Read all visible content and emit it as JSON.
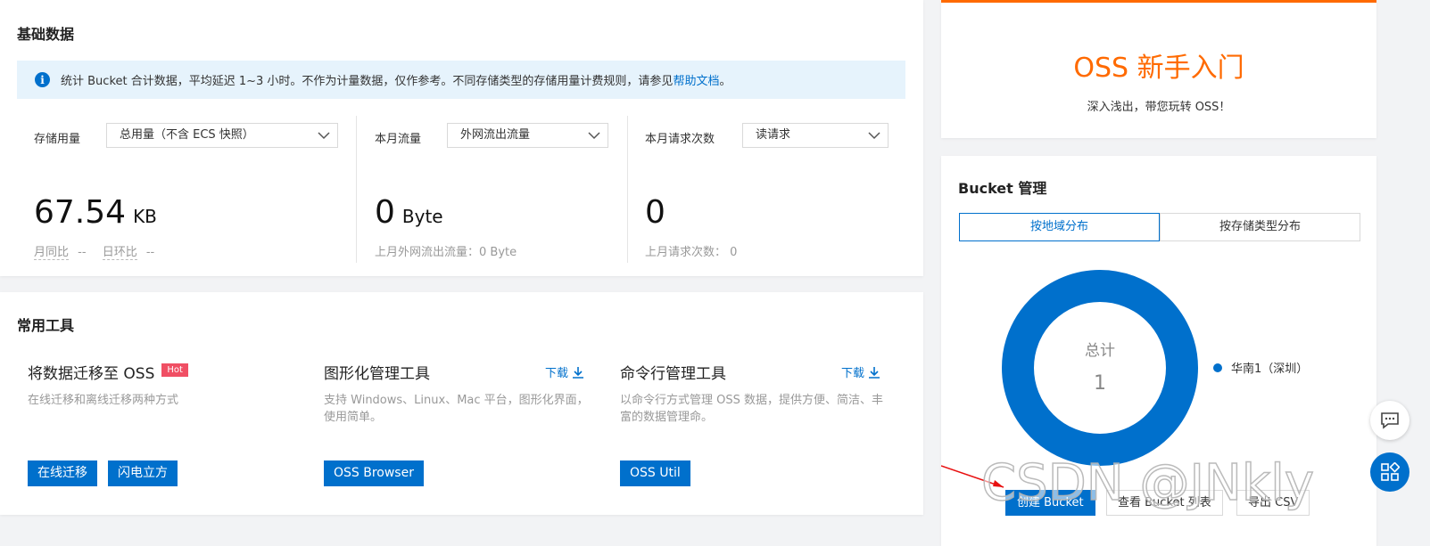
{
  "basic": {
    "title": "基础数据",
    "notice_text": "统计 Bucket 合计数据，平均延迟 1~3 小时。不作为计量数据，仅作参考。不同存储类型的存储用量计费规则，请参见",
    "notice_link": "帮助文档",
    "notice_end": "。",
    "storage": {
      "label": "存储用量",
      "select": "总用量（不含 ECS 快照）",
      "value": "67.54",
      "unit": "KB",
      "mom_label": "月同比",
      "mom_value": "--",
      "dod_label": "日环比",
      "dod_value": "--"
    },
    "traffic": {
      "label": "本月流量",
      "select": "外网流出流量",
      "value": "0",
      "unit": "Byte",
      "prev": "上月外网流出流量：0 Byte"
    },
    "requests": {
      "label": "本月请求次数",
      "select": "读请求",
      "value": "0",
      "prev": "上月请求次数： 0"
    }
  },
  "tools": {
    "title": "常用工具",
    "migrate": {
      "title": "将数据迁移至 OSS",
      "badge": "Hot",
      "desc": "在线迁移和离线迁移两种方式",
      "btn1": "在线迁移",
      "btn2": "闪电立方"
    },
    "gui": {
      "title": "图形化管理工具",
      "download": "下载",
      "desc": "支持 Windows、Linux、Mac 平台，图形化界面，使用简单。",
      "btn": "OSS Browser"
    },
    "cli": {
      "title": "命令行管理工具",
      "download": "下载",
      "desc": "以命令行方式管理 OSS 数据，提供方便、简洁、丰富的数据管理命。",
      "btn": "OSS Util"
    }
  },
  "guide": {
    "title": "OSS 新手入门",
    "subtitle": "深入浅出，带您玩转 OSS！"
  },
  "bucket": {
    "title": "Bucket 管理",
    "tabs": [
      "按地域分布",
      "按存储类型分布"
    ],
    "donut_total_label": "总计",
    "donut_total_value": "1",
    "legend": [
      {
        "name": "华南1（深圳）",
        "value": 1,
        "color": "#0070cc"
      }
    ],
    "buttons": [
      "创建 Bucket",
      "查看 Bucket 列表",
      "导出 CSV"
    ]
  },
  "watermark": "CSDN @JNkly",
  "colors": {
    "accent": "#0070cc",
    "orange": "#ff6a00",
    "hot": "#f04f64"
  }
}
